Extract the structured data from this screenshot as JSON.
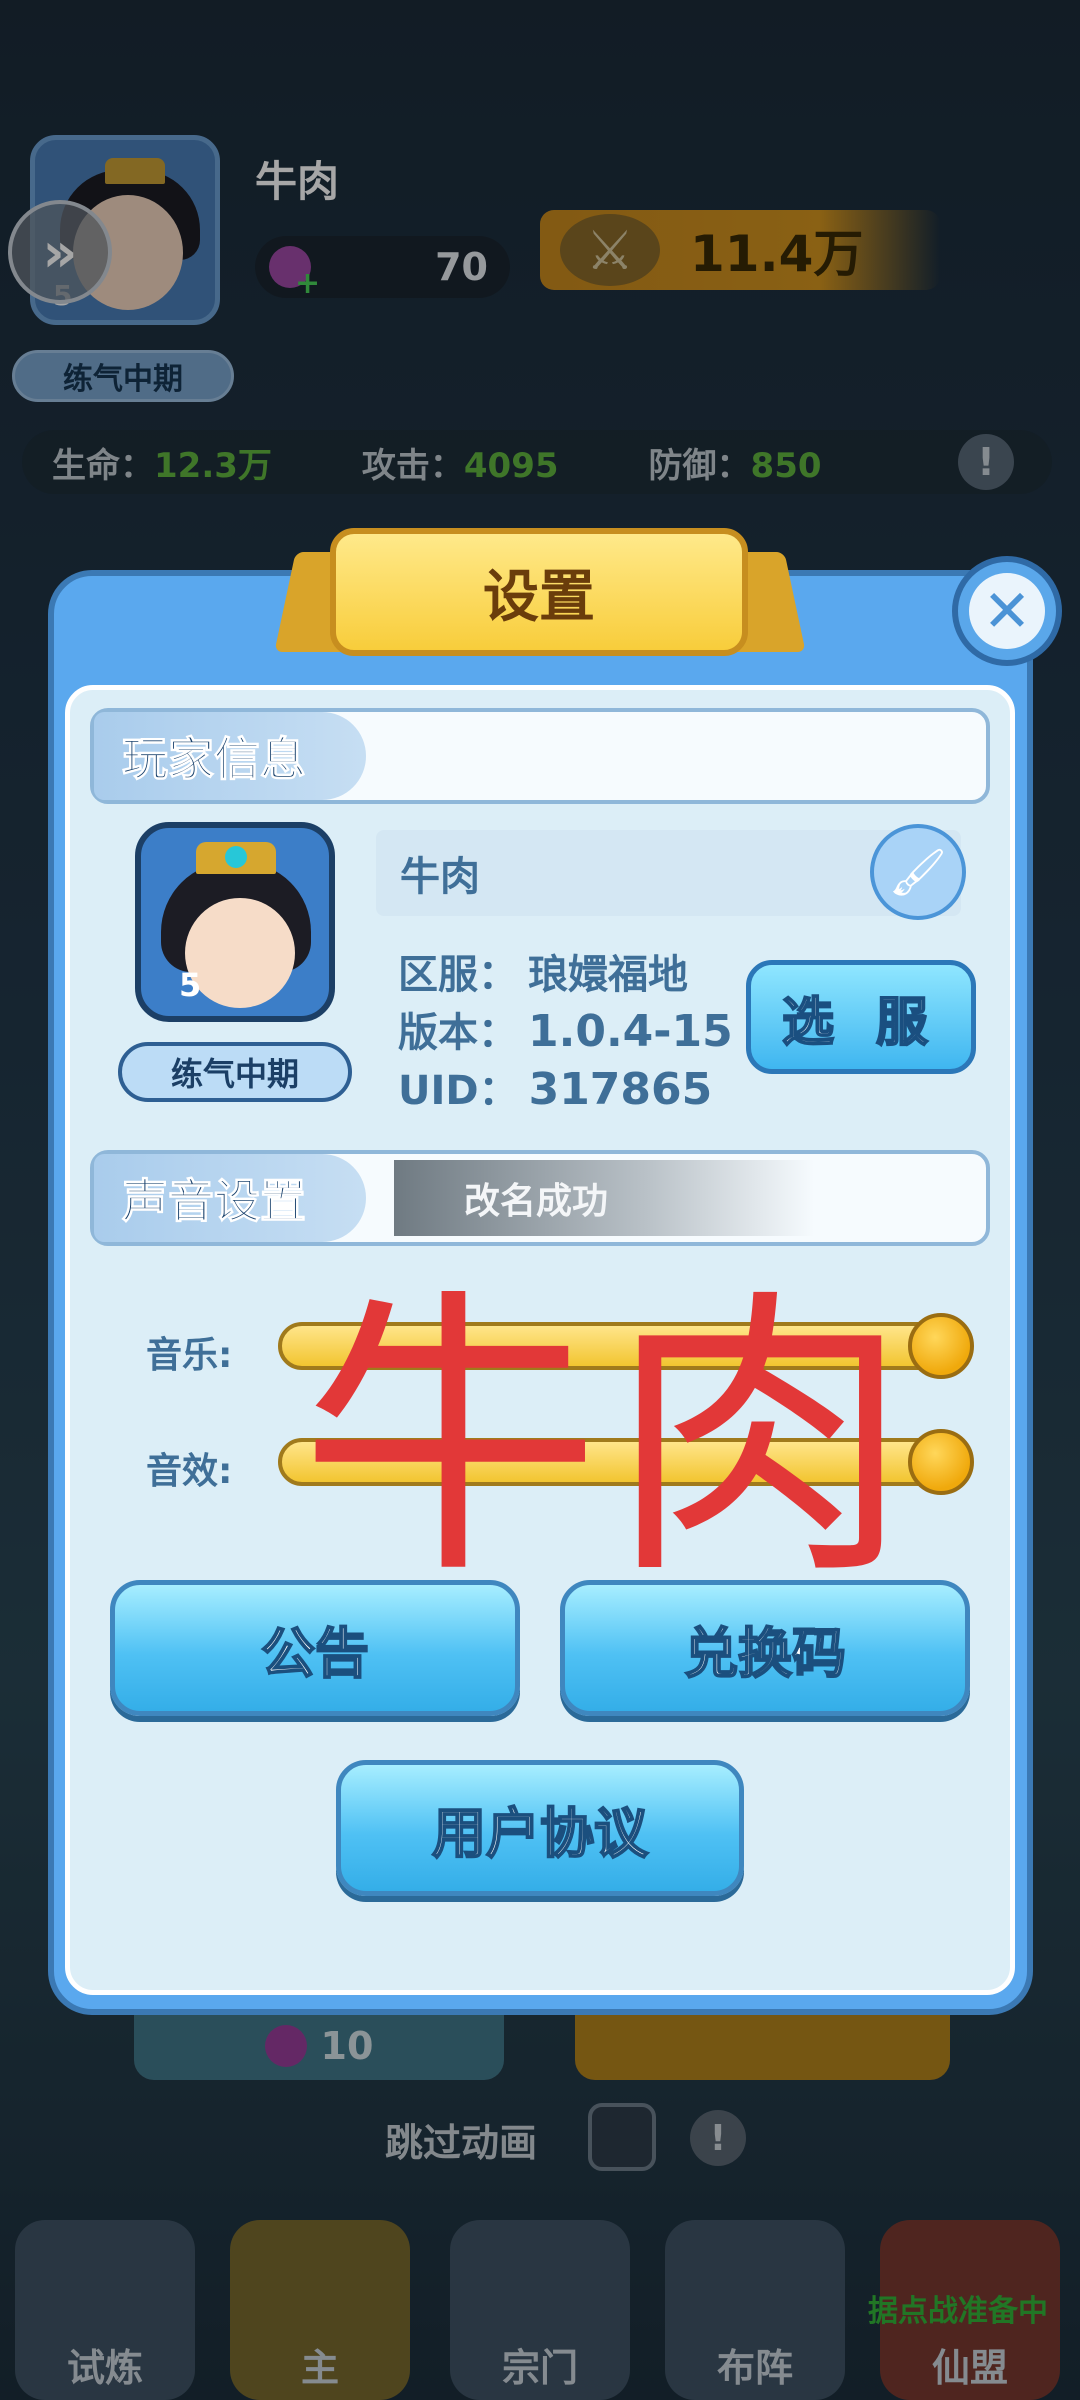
{
  "hud": {
    "player_name": "牛肉",
    "avatar_level": "5",
    "realm": "练气中期",
    "energy": "70",
    "power": "11.4万",
    "stats": [
      {
        "label": "生命：",
        "value": "12.3万"
      },
      {
        "label": "攻击：",
        "value": "4095"
      },
      {
        "label": "防御：",
        "value": "850"
      }
    ]
  },
  "background": {
    "chip_value": "10",
    "skip_label": "跳过动画",
    "nav": [
      "试炼",
      "主",
      "宗门",
      "布阵",
      "仙盟"
    ],
    "nav_status": "据点战准备中"
  },
  "dialog": {
    "title": "设置",
    "player_section": "玩家信息",
    "name": "牛肉",
    "avatar_level": "5",
    "realm": "练气中期",
    "server_label": "区服：",
    "server_value": "琅嬛福地",
    "version_label": "版本：",
    "version_value": "1.0.4-15",
    "uid_label": "UID：",
    "uid_value": "317865",
    "select_server": "选 服",
    "sound_section": "声音设置",
    "toast": "改名成功",
    "music_label": "音乐:",
    "sfx_label": "音效:",
    "music_level": 1.0,
    "sfx_level": 1.0,
    "notice_btn": "公告",
    "redeem_btn": "兑换码",
    "agreement_btn": "用户协议"
  },
  "watermark": "牛肉",
  "colors": {
    "panel_blue": "#5aa8ee",
    "title_gold": "#f8cd3b",
    "button_cyan": "#4fc1f4",
    "watermark_red": "#e23838",
    "stat_green": "#61b53f"
  }
}
